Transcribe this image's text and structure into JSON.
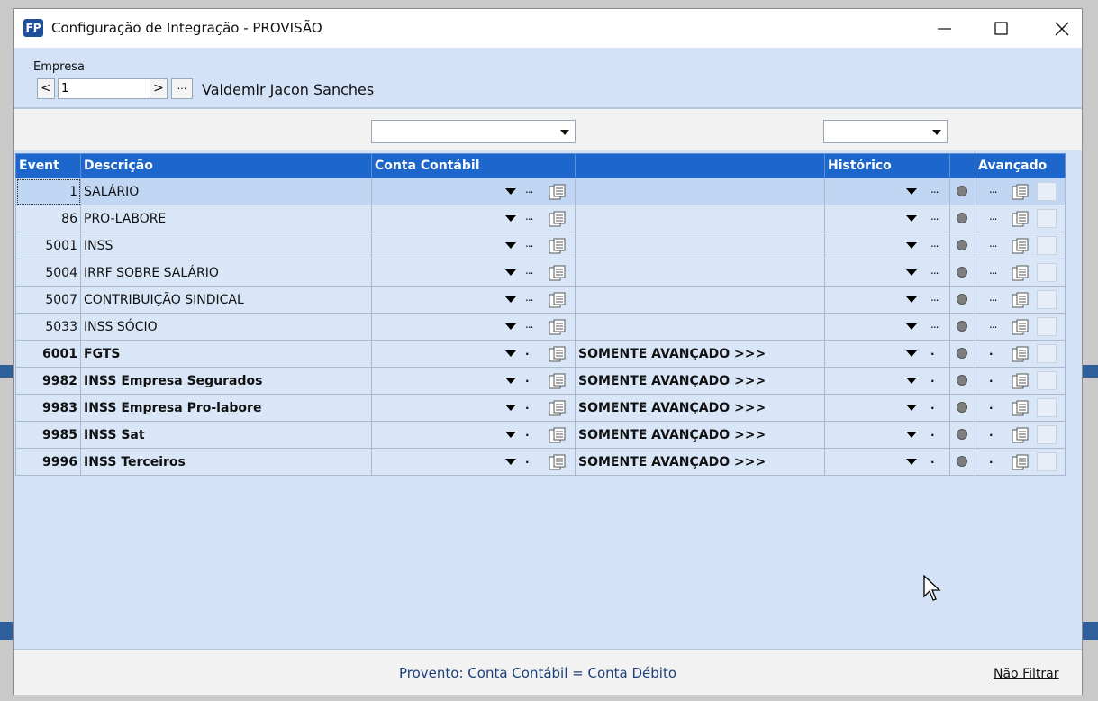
{
  "window": {
    "app_logo": "FP",
    "title": "Configuração de Integração - PROVISÃO"
  },
  "empresa": {
    "label": "Empresa",
    "prev_label": "<",
    "value": "1",
    "next_label": ">",
    "more_label": "···",
    "name": "Valdemir Jacon Sanches"
  },
  "grid": {
    "headers": {
      "event": "Event",
      "descricao": "Descrição",
      "conta_contabil": "Conta Contábil",
      "historico": "Histórico",
      "avancado": "Avançado"
    },
    "rows": [
      {
        "code": "1",
        "desc": "SALÁRIO",
        "conta": "",
        "hist": "",
        "dots": "...",
        "adv_dots": "..."
      },
      {
        "code": "86",
        "desc": "PRO-LABORE",
        "conta": "",
        "hist": "",
        "dots": "...",
        "adv_dots": "..."
      },
      {
        "code": "5001",
        "desc": "INSS",
        "conta": "",
        "hist": "",
        "dots": "...",
        "adv_dots": "..."
      },
      {
        "code": "5004",
        "desc": "IRRF SOBRE SALÁRIO",
        "conta": "",
        "hist": "",
        "dots": "...",
        "adv_dots": "..."
      },
      {
        "code": "5007",
        "desc": "CONTRIBUIÇÃO SINDICAL",
        "conta": "",
        "hist": "",
        "dots": "...",
        "adv_dots": "..."
      },
      {
        "code": "5033",
        "desc": "INSS SÓCIO",
        "conta": "",
        "hist": "",
        "dots": "...",
        "adv_dots": "..."
      },
      {
        "code": "6001",
        "desc": "FGTS",
        "conta": "SOMENTE AVANÇADO >>>",
        "hist": "",
        "dots": ".",
        "adv_dots": "."
      },
      {
        "code": "9982",
        "desc": "INSS Empresa Segurados",
        "conta": "SOMENTE AVANÇADO >>>",
        "hist": "",
        "dots": ".",
        "adv_dots": "."
      },
      {
        "code": "9983",
        "desc": "INSS Empresa Pro-labore",
        "conta": "SOMENTE AVANÇADO >>>",
        "hist": "",
        "dots": ".",
        "adv_dots": "."
      },
      {
        "code": "9985",
        "desc": "INSS Sat",
        "conta": "SOMENTE AVANÇADO >>>",
        "hist": "",
        "dots": ".",
        "adv_dots": "."
      },
      {
        "code": "9996",
        "desc": "INSS Terceiros",
        "conta": "SOMENTE AVANÇADO >>>",
        "hist": "",
        "dots": ".",
        "adv_dots": "."
      }
    ]
  },
  "footer": {
    "legend": "Provento: Conta Contábil = Conta Débito",
    "nao_filtrar": "Não Filtrar"
  },
  "colors": {
    "header_bg": "#1d67cc",
    "window_bg": "#d3e2f6",
    "row_bg": "#d8e6f8"
  },
  "icons": [
    "minimize-icon",
    "maximize-icon",
    "close-icon",
    "dropdown-arrow-icon",
    "copy-icon",
    "status-circle-icon",
    "cursor-arrow-icon"
  ]
}
